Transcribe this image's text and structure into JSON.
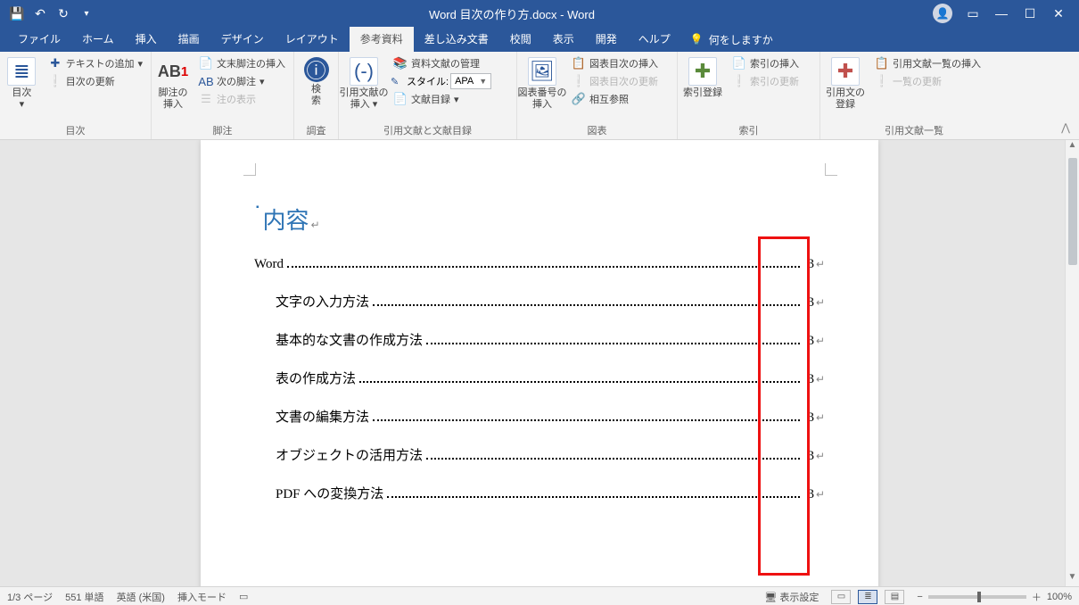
{
  "title": "Word  目次の作り方.docx  -  Word",
  "tabs": [
    "ファイル",
    "ホーム",
    "挿入",
    "描画",
    "デザイン",
    "レイアウト",
    "参考資料",
    "差し込み文書",
    "校閲",
    "表示",
    "開発",
    "ヘルプ"
  ],
  "active_tab_index": 6,
  "tell_me": "何をしますか",
  "ribbon": {
    "toc": {
      "main": "目次",
      "add_text": "テキストの追加",
      "update": "目次の更新",
      "group": "目次"
    },
    "footnotes": {
      "main": "脚注の\n挿入",
      "endnote": "文末脚注の挿入",
      "next": "次の脚注",
      "show": "注の表示",
      "group": "脚注"
    },
    "research": {
      "main": "検\n索",
      "group": "調査"
    },
    "citations": {
      "main": "引用文献の\n挿入",
      "manage": "資料文献の管理",
      "style_label": "スタイル:",
      "style_value": "APA",
      "biblio": "文献目録",
      "group": "引用文献と文献目録"
    },
    "captions": {
      "main": "図表番号の\n挿入",
      "insert_tof": "図表目次の挿入",
      "update_tof": "図表目次の更新",
      "crossref": "相互参照",
      "group": "図表"
    },
    "index": {
      "main": "索引登録",
      "insert": "索引の挿入",
      "update": "索引の更新",
      "group": "索引"
    },
    "authorities": {
      "main": "引用文の\n登録",
      "insert": "引用文献一覧の挿入",
      "update": "一覧の更新",
      "group": "引用文献一覧"
    }
  },
  "document": {
    "heading": "内容",
    "toc": [
      {
        "level": 1,
        "text": "Word",
        "page": "3"
      },
      {
        "level": 2,
        "text": "文字の入力方法",
        "page": "3"
      },
      {
        "level": 2,
        "text": "基本的な文書の作成方法",
        "page": "3"
      },
      {
        "level": 2,
        "text": "表の作成方法",
        "page": "3"
      },
      {
        "level": 2,
        "text": "文書の編集方法",
        "page": "3"
      },
      {
        "level": 2,
        "text": "オブジェクトの活用方法",
        "page": "3"
      },
      {
        "level": 2,
        "text": "PDF への変換方法",
        "page": "3"
      }
    ]
  },
  "statusbar": {
    "page": "1/3 ページ",
    "words": "551 単語",
    "lang": "英語 (米国)",
    "mode": "挿入モード",
    "display": "表示設定",
    "zoom": "100%"
  }
}
